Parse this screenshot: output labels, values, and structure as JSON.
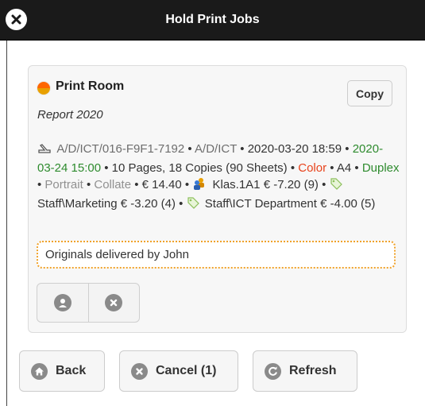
{
  "header": {
    "title": "Hold Print Jobs"
  },
  "job": {
    "printer_name": "Print Room",
    "printer_status_colors": [
      "#ff6600",
      "#e8a000"
    ],
    "copy_label": "Copy",
    "title": "Report 2020",
    "user_path": "A/D/ICT/016-F9F1-7192",
    "user_group": "A/D/ICT",
    "submitted": "2020-03-20 18:59",
    "expires": "2020-03-24 15:00",
    "pages_copies": "10 Pages, 18 Copies (90 Sheets)",
    "color": "Color",
    "paper": "A4",
    "duplex": "Duplex",
    "orientation": "Portrait",
    "collate": "Collate",
    "cost": "€ 14.40",
    "accounts": [
      {
        "name": "Klas.1A1",
        "amount": "€ -7.20",
        "count": "(9)",
        "icon": "group-icon"
      },
      {
        "name": "Staff\\Marketing",
        "amount": "€ -3.20",
        "count": "(4)",
        "icon": "tag-icon"
      },
      {
        "name": "Staff\\ICT Department",
        "amount": "€ -4.00",
        "count": "(5)",
        "icon": "tag-icon"
      }
    ],
    "note": "Originals delivered by John",
    "action_icons": [
      "user-icon",
      "cancel-icon"
    ]
  },
  "footer": {
    "back_label": "Back",
    "cancel_label": "Cancel (1)",
    "refresh_label": "Refresh"
  },
  "colors": {
    "header_bg": "#1a1a1a",
    "expires_green": "#2e8b2e",
    "color_red": "#e8431c",
    "note_border": "#f0a22a"
  }
}
